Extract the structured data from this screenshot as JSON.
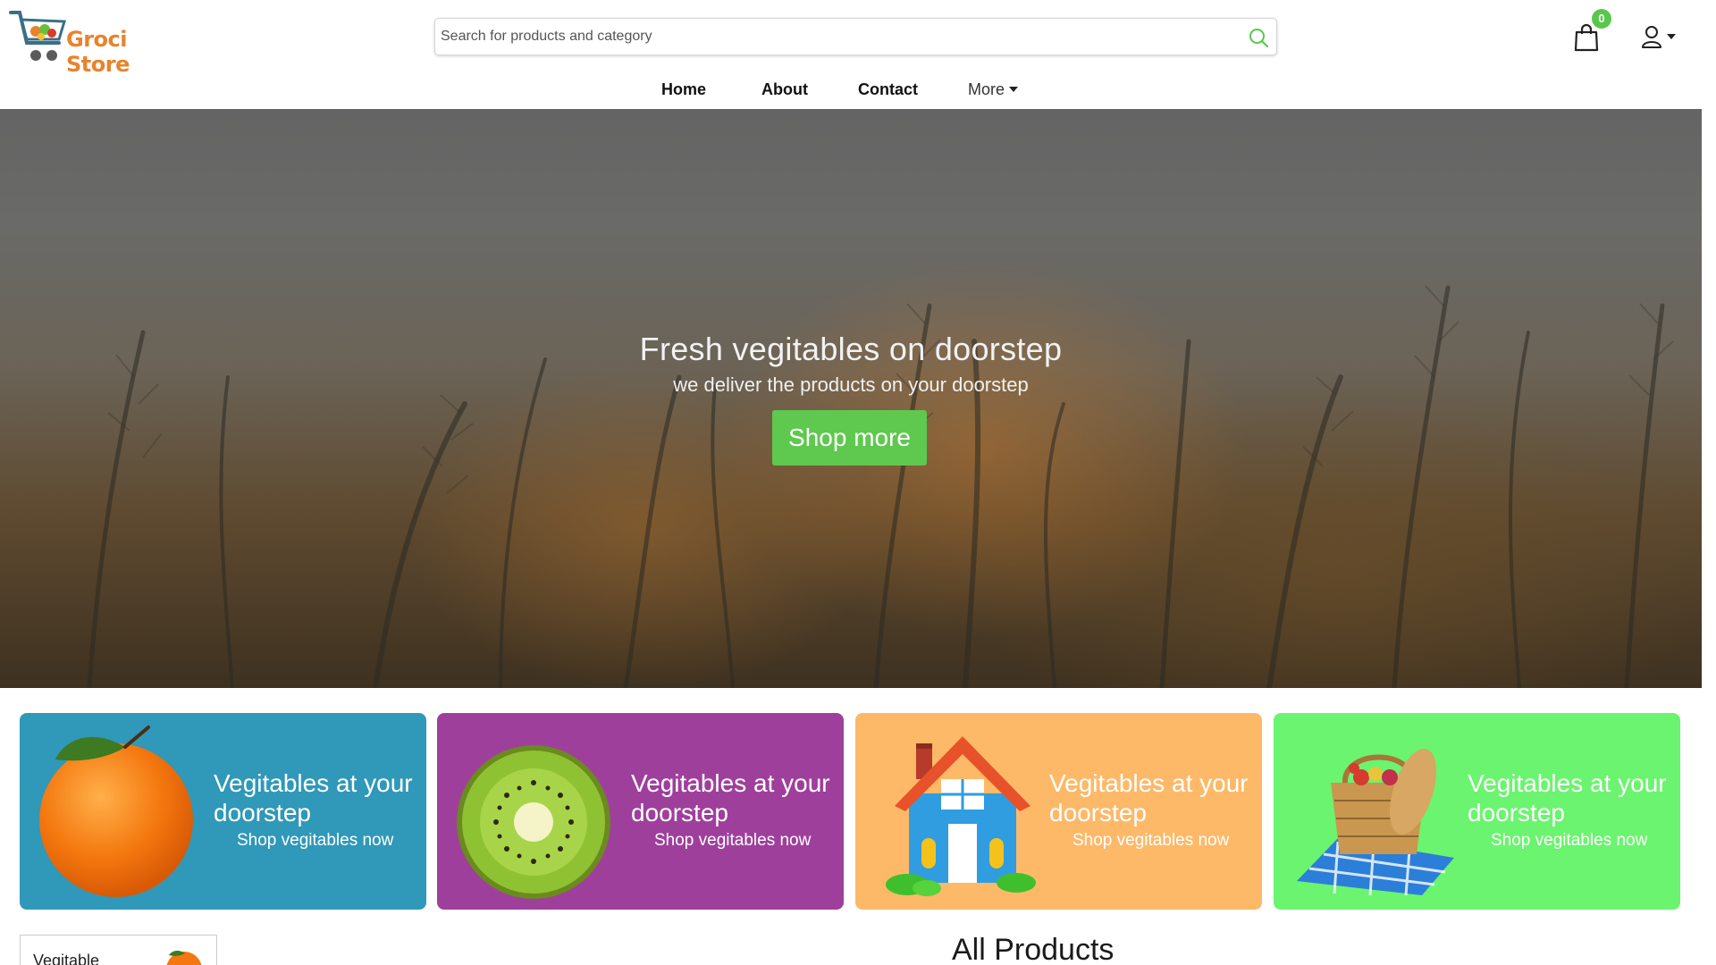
{
  "header": {
    "logo_text": "Groci Store",
    "search_placeholder": "Search for products and category",
    "cart_count": "0",
    "accent_color": "#57c84d"
  },
  "nav": {
    "items": [
      {
        "label": "Home"
      },
      {
        "label": "About"
      },
      {
        "label": "Contact"
      }
    ],
    "more_label": "More"
  },
  "hero": {
    "title": "Fresh vegitables on doorstep",
    "subtitle": "we deliver the products on your doorstep",
    "button_label": "Shop more",
    "button_color": "#5fc84f"
  },
  "features": [
    {
      "title": "Vegitables at your doorstep",
      "link": "Shop vegitables now",
      "color": "#3098b8",
      "image": "orange-icon"
    },
    {
      "title": "Vegitables at your doorstep",
      "link": "Shop vegitables now",
      "color": "#9f3f9c",
      "image": "kiwi-icon"
    },
    {
      "title": "Vegitables at your doorstep",
      "link": "Shop vegitables now",
      "color": "#fdb968",
      "image": "house-icon"
    },
    {
      "title": "Vegitables at your doorstep",
      "link": "Shop vegitables now",
      "color": "#6bf46f",
      "image": "basket-icon"
    }
  ],
  "sidebar_card": {
    "label": "Vegitable"
  },
  "section": {
    "title": "All Products"
  }
}
